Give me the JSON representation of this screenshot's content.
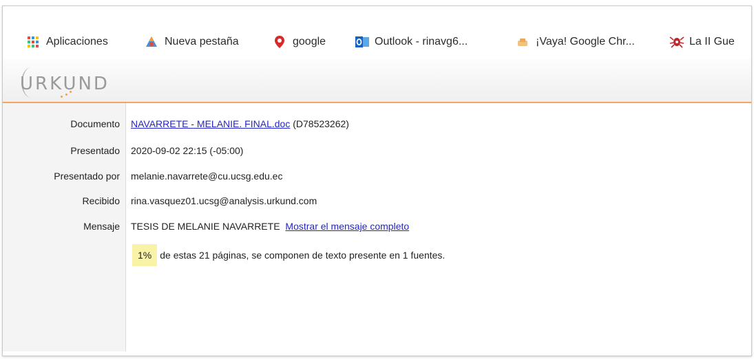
{
  "bookmarks": [
    {
      "label": "Aplicaciones",
      "icon": "apps-grid-icon"
    },
    {
      "label": "Nueva pestaña",
      "icon": "new-tab-icon"
    },
    {
      "label": "google",
      "icon": "google-pin-icon"
    },
    {
      "label": "Outlook - rinavg6...",
      "icon": "outlook-icon"
    },
    {
      "label": "¡Vaya! Google Chr...",
      "icon": "chrome-error-icon"
    },
    {
      "label": "La II Gue",
      "icon": "spider-icon"
    }
  ],
  "brand": {
    "logo_text": "URKUND",
    "accent_color": "#f2a65a"
  },
  "report": {
    "documento_label": "Documento",
    "documento_link": "NAVARRETE - MELANIE. FINAL.doc",
    "documento_id": "(D78523262)",
    "presentado_label": "Presentado",
    "presentado_value": "2020-09-02 22:15 (-05:00)",
    "presentado_por_label": "Presentado por",
    "presentado_por_value": "melanie.navarrete@cu.ucsg.edu.ec",
    "recibido_label": "Recibido",
    "recibido_value": "rina.vasquez01.ucsg@analysis.urkund.com",
    "mensaje_label": "Mensaje",
    "mensaje_value": "TESIS DE MELANIE NAVARRETE",
    "mensaje_link": "Mostrar el mensaje completo",
    "percent": "1%",
    "summary": "de estas 21 páginas, se componen de texto presente en 1 fuentes."
  }
}
